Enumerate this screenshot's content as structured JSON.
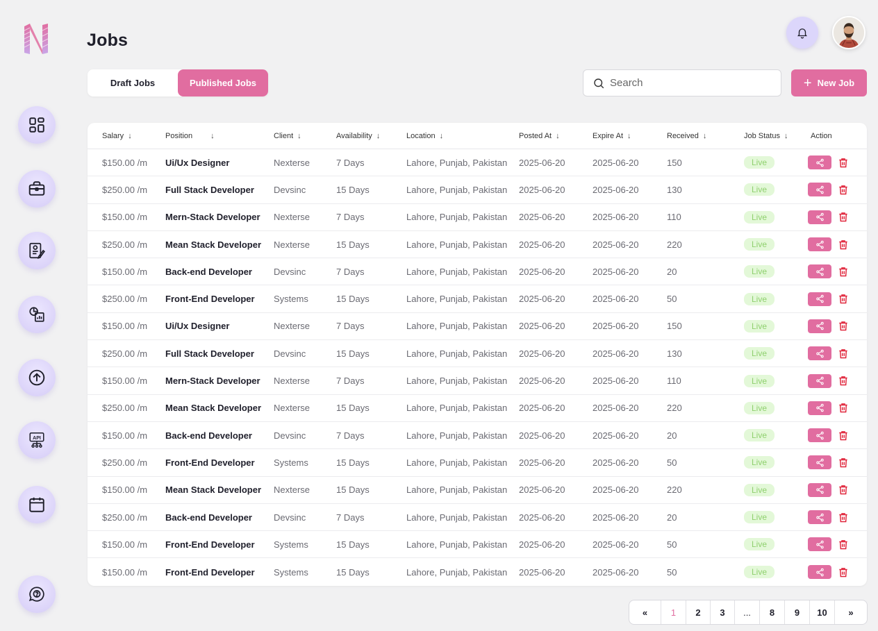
{
  "header": {
    "title": "Jobs"
  },
  "tabs": {
    "draft": "Draft Jobs",
    "published": "Published Jobs",
    "active": "published"
  },
  "search": {
    "placeholder": "Search",
    "value": ""
  },
  "new_job_label": "New Job",
  "sidebar": {
    "items": [
      {
        "icon": "dashboard-icon"
      },
      {
        "icon": "briefcase-icon"
      },
      {
        "icon": "resume-icon"
      },
      {
        "icon": "report-chart-icon"
      },
      {
        "icon": "upload-icon"
      },
      {
        "icon": "api-icon"
      },
      {
        "icon": "calendar-icon"
      },
      {
        "icon": "help-chat-icon"
      }
    ]
  },
  "table": {
    "headers": [
      "Salary",
      "Position",
      "Client",
      "Availability",
      "Location",
      "Posted At",
      "Expire At",
      "Received",
      "Job Status",
      "Action"
    ],
    "rows": [
      {
        "salary": "$150.00 /m",
        "position": "Ui/Ux Designer",
        "client": "Nexterse",
        "availability": "7 Days",
        "location": "Lahore, Punjab, Pakistan",
        "posted": "2025-06-20",
        "expire": "2025-06-20",
        "received": "150",
        "status": "Live"
      },
      {
        "salary": "$250.00 /m",
        "position": "Full Stack Developer",
        "client": "Devsinc",
        "availability": "15 Days",
        "location": "Lahore, Punjab, Pakistan",
        "posted": "2025-06-20",
        "expire": "2025-06-20",
        "received": "130",
        "status": "Live"
      },
      {
        "salary": "$150.00 /m",
        "position": "Mern-Stack Developer",
        "client": "Nexterse",
        "availability": "7 Days",
        "location": "Lahore, Punjab, Pakistan",
        "posted": "2025-06-20",
        "expire": "2025-06-20",
        "received": "110",
        "status": "Live"
      },
      {
        "salary": "$250.00 /m",
        "position": "Mean Stack Developer",
        "client": "Nexterse",
        "availability": "15 Days",
        "location": "Lahore, Punjab, Pakistan",
        "posted": "2025-06-20",
        "expire": "2025-06-20",
        "received": "220",
        "status": "Live"
      },
      {
        "salary": "$150.00 /m",
        "position": "Back-end Developer",
        "client": "Devsinc",
        "availability": "7 Days",
        "location": "Lahore, Punjab, Pakistan",
        "posted": "2025-06-20",
        "expire": "2025-06-20",
        "received": "20",
        "status": "Live"
      },
      {
        "salary": "$250.00 /m",
        "position": "Front-End Developer",
        "client": "Systems",
        "availability": "15 Days",
        "location": "Lahore, Punjab, Pakistan",
        "posted": "2025-06-20",
        "expire": "2025-06-20",
        "received": "50",
        "status": "Live"
      },
      {
        "salary": "$150.00 /m",
        "position": "Ui/Ux Designer",
        "client": "Nexterse",
        "availability": "7 Days",
        "location": "Lahore, Punjab, Pakistan",
        "posted": "2025-06-20",
        "expire": "2025-06-20",
        "received": "150",
        "status": "Live"
      },
      {
        "salary": "$250.00 /m",
        "position": "Full Stack Developer",
        "client": "Devsinc",
        "availability": "15 Days",
        "location": "Lahore, Punjab, Pakistan",
        "posted": "2025-06-20",
        "expire": "2025-06-20",
        "received": "130",
        "status": "Live"
      },
      {
        "salary": "$150.00 /m",
        "position": "Mern-Stack Developer",
        "client": "Nexterse",
        "availability": "7 Days",
        "location": "Lahore, Punjab, Pakistan",
        "posted": "2025-06-20",
        "expire": "2025-06-20",
        "received": "110",
        "status": "Live"
      },
      {
        "salary": "$250.00 /m",
        "position": "Mean Stack Developer",
        "client": "Nexterse",
        "availability": "15 Days",
        "location": "Lahore, Punjab, Pakistan",
        "posted": "2025-06-20",
        "expire": "2025-06-20",
        "received": "220",
        "status": "Live"
      },
      {
        "salary": "$150.00 /m",
        "position": "Back-end Developer",
        "client": "Devsinc",
        "availability": "7 Days",
        "location": "Lahore, Punjab, Pakistan",
        "posted": "2025-06-20",
        "expire": "2025-06-20",
        "received": "20",
        "status": "Live"
      },
      {
        "salary": "$250.00 /m",
        "position": "Front-End Developer",
        "client": "Systems",
        "availability": "15 Days",
        "location": "Lahore, Punjab, Pakistan",
        "posted": "2025-06-20",
        "expire": "2025-06-20",
        "received": "50",
        "status": "Live"
      },
      {
        "salary": "$150.00 /m",
        "position": "Mean Stack Developer",
        "client": "Nexterse",
        "availability": "15 Days",
        "location": "Lahore, Punjab, Pakistan",
        "posted": "2025-06-20",
        "expire": "2025-06-20",
        "received": "220",
        "status": "Live"
      },
      {
        "salary": "$250.00 /m",
        "position": "Back-end Developer",
        "client": "Devsinc",
        "availability": "7 Days",
        "location": "Lahore, Punjab, Pakistan",
        "posted": "2025-06-20",
        "expire": "2025-06-20",
        "received": "20",
        "status": "Live"
      },
      {
        "salary": "$150.00 /m",
        "position": "Front-End Developer",
        "client": "Systems",
        "availability": "15 Days",
        "location": "Lahore, Punjab, Pakistan",
        "posted": "2025-06-20",
        "expire": "2025-06-20",
        "received": "50",
        "status": "Live"
      },
      {
        "salary": "$150.00 /m",
        "position": "Front-End Developer",
        "client": "Systems",
        "availability": "15 Days",
        "location": "Lahore, Punjab, Pakistan",
        "posted": "2025-06-20",
        "expire": "2025-06-20",
        "received": "50",
        "status": "Live"
      }
    ]
  },
  "pagination": {
    "first": "«",
    "pages": [
      "1",
      "2",
      "3",
      "...",
      "8",
      "9",
      "10"
    ],
    "last": "»",
    "current": "1"
  },
  "colors": {
    "accent": "#e16da0",
    "live_bg": "#e3f8d8",
    "live_text": "#8fd06e",
    "delete": "#e0243a",
    "sidebar_btn": "#dcd4f9"
  }
}
